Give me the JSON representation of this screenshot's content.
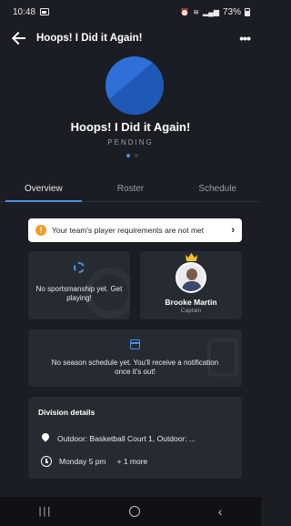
{
  "status_bar": {
    "time": "10:48",
    "battery": "73%"
  },
  "app_bar": {
    "title": "Hoops! I Did it Again!"
  },
  "team": {
    "name": "Hoops! I Did it Again!",
    "status": "PENDING",
    "logo_colors": [
      "#2f6fd8",
      "#2058b8"
    ]
  },
  "tabs": [
    {
      "label": "Overview",
      "active": true
    },
    {
      "label": "Roster",
      "active": false
    },
    {
      "label": "Schedule",
      "active": false
    }
  ],
  "alert": {
    "text": "Your team's player requirements are not met",
    "icon": "warning-icon"
  },
  "sportsmanship": {
    "text": "No sportsmanship yet. Get playing!"
  },
  "captain": {
    "name": "Brooke Martin",
    "role": "Captain"
  },
  "schedule": {
    "text": "No season schedule yet. You'll receive a notification once it's out!"
  },
  "division": {
    "title": "Division details",
    "location": "Outdoor: Basketball Court 1, Outdoor: ...",
    "time": "Monday 5 pm",
    "more": "+ 1 more"
  },
  "colors": {
    "accent": "#4a90e2",
    "warning": "#f29b23",
    "background": "#1a1d23",
    "card": "#262a31"
  }
}
